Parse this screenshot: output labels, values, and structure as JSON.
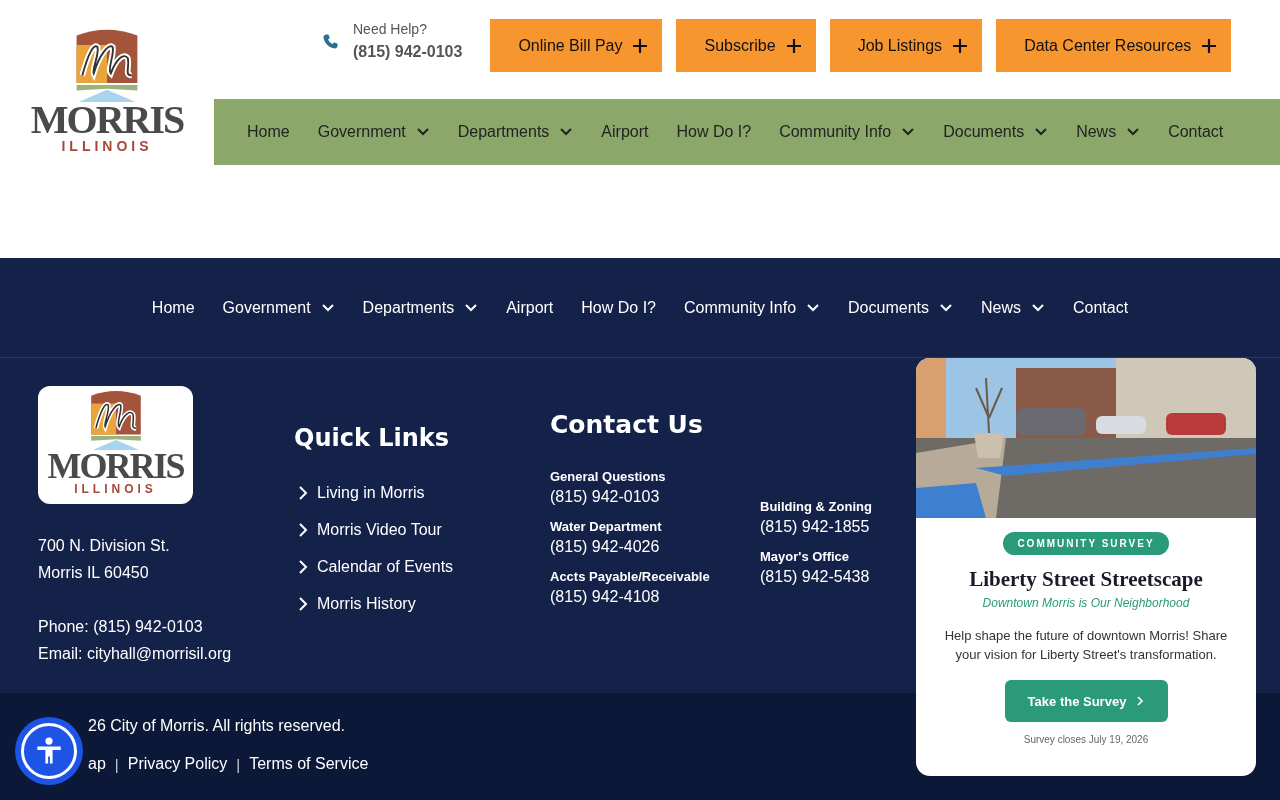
{
  "header": {
    "logo": {
      "wordmark": "MORRIS",
      "subtitle": "ILLINOIS"
    },
    "help": {
      "label": "Need Help?",
      "phone": "(815) 942-0103"
    },
    "buttons": [
      {
        "label": "Online Bill Pay"
      },
      {
        "label": "Subscribe"
      },
      {
        "label": "Job Listings"
      },
      {
        "label": "Data Center Resources"
      }
    ],
    "nav": [
      {
        "label": "Home",
        "has_menu": false
      },
      {
        "label": "Government",
        "has_menu": true
      },
      {
        "label": "Departments",
        "has_menu": true
      },
      {
        "label": "Airport",
        "has_menu": false
      },
      {
        "label": "How Do I?",
        "has_menu": false
      },
      {
        "label": "Community Info",
        "has_menu": true
      },
      {
        "label": "Documents",
        "has_menu": true
      },
      {
        "label": "News",
        "has_menu": true
      },
      {
        "label": "Contact",
        "has_menu": false
      }
    ]
  },
  "footer_nav": [
    {
      "label": "Home",
      "has_menu": false
    },
    {
      "label": "Government",
      "has_menu": true
    },
    {
      "label": "Departments",
      "has_menu": true
    },
    {
      "label": "Airport",
      "has_menu": false
    },
    {
      "label": "How Do I?",
      "has_menu": false
    },
    {
      "label": "Community Info",
      "has_menu": true
    },
    {
      "label": "Documents",
      "has_menu": true
    },
    {
      "label": "News",
      "has_menu": true
    },
    {
      "label": "Contact",
      "has_menu": false
    }
  ],
  "footer": {
    "logo": {
      "wordmark": "MORRIS",
      "subtitle": "ILLINOIS"
    },
    "address": [
      "700 N. Division St.",
      "Morris IL 60450"
    ],
    "phone": "Phone: (815) 942-0103",
    "email": "Email: cityhall@morrisil.org",
    "quick_links": {
      "title": "Quick Links",
      "items": [
        "Living in Morris",
        "Morris Video Tour",
        "Calendar of Events",
        "Morris History"
      ]
    },
    "contact": {
      "title": "Contact Us",
      "columns": [
        [
          {
            "label": "General Questions",
            "phone": "(815) 942-0103"
          },
          {
            "label": "Water Department",
            "phone": "(815) 942-4026"
          },
          {
            "label": "Accts Payable/Receivable",
            "phone": "(815) 942-4108"
          }
        ],
        [
          {
            "label": "Building & Zoning",
            "phone": "(815) 942-1855"
          },
          {
            "label": "Mayor's Office",
            "phone": "(815) 942-5438"
          }
        ]
      ]
    },
    "copyright": "26 City of Morris. All rights reserved.",
    "links": [
      {
        "kind": "link",
        "text": "ap"
      },
      {
        "kind": "separator",
        "text": "|"
      },
      {
        "kind": "link",
        "text": "Privacy Policy"
      },
      {
        "kind": "separator",
        "text": "|"
      },
      {
        "kind": "link",
        "text": "Terms of Service"
      }
    ]
  },
  "survey_card": {
    "badge": "COMMUNITY SURVEY",
    "title": "Liberty Street Streetscape",
    "subtitle": "Downtown Morris is Our Neighborhood",
    "text": "Help shape the future of downtown Morris! Share your vision for Liberty Street's transformation.",
    "button": "Take the Survey",
    "note": "Survey closes July 19, 2026"
  }
}
